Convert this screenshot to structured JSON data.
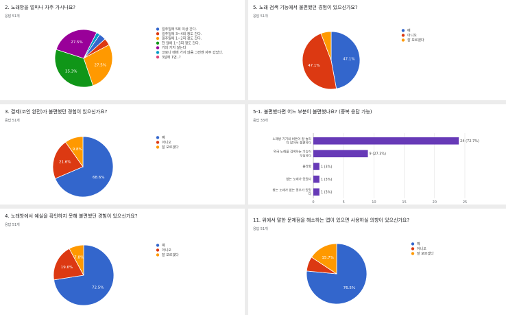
{
  "charts": [
    {
      "id": "q2",
      "title": "2. 노래방을 얼마나 자주 가시나요?",
      "responses": "응답 51개",
      "chart_data": {
        "type": "pie",
        "labels": [
          "일주일에 5회 이상 간다.",
          "일주일에 3~4회 정도 간다.",
          "일주일에 1~2회 정도 간다.",
          "한 달에 1~3회 정도 간다.",
          "거의 가지 않는다",
          "코로나 때에 가지 않음 그전엔 자주 갔었다.",
          "3달에 1번..?"
        ],
        "values": [
          3.9,
          3.9,
          27.5,
          35.3,
          27.5,
          2.0,
          0
        ],
        "colors": [
          "#3366cc",
          "#dc3912",
          "#ff9900",
          "#109618",
          "#990099",
          "#0099c6",
          "#dd4477"
        ],
        "slice_labels": [
          "",
          "",
          "27.5%",
          "35.3%",
          "27.5%",
          "",
          ""
        ]
      }
    },
    {
      "id": "q5",
      "title": "5. 노래 검색 기능에서 불편했던 경험이 있으신가요?",
      "responses": "응답 51개",
      "chart_data": {
        "type": "pie",
        "labels": [
          "예",
          "아니오",
          "잘 모르겠다"
        ],
        "values": [
          47.1,
          47.1,
          5.8
        ],
        "colors": [
          "#3366cc",
          "#dc3912",
          "#ff9900"
        ],
        "slice_labels": [
          "47.1%",
          "47.1%",
          ""
        ]
      }
    },
    {
      "id": "q3",
      "title": "3. 결제(코인 완전)가 불편했던 경험이 있으신가요?",
      "responses": "응답 51개",
      "chart_data": {
        "type": "pie",
        "labels": [
          "예",
          "아니오",
          "잘 모르겠다"
        ],
        "values": [
          68.6,
          21.6,
          9.8
        ],
        "colors": [
          "#3366cc",
          "#dc3912",
          "#ff9900"
        ],
        "slice_labels": [
          "68.6%",
          "21.6%",
          "9.8%"
        ]
      }
    },
    {
      "id": "q51",
      "title": "5-1. 불편했다면 어느 부분이 불편했나요? (중복 응답 가능)",
      "responses": "응답 33개",
      "chart_data": {
        "type": "bar",
        "categories": [
          "노래방 기기의 버튼이 잘 눌리지 않아서 불편하다",
          "외국 노래를 검색하는 기능이 부실하다",
          "몰라할",
          "없는 노래가 있었다",
          "찾는 노래가 없는 경우가 있었다"
        ],
        "values": [
          24,
          9,
          1,
          1,
          1
        ],
        "value_labels": [
          "24 (72.7%)",
          "9 (27.3%)",
          "1 (3%)",
          "1 (3%)",
          "1 (3%)"
        ],
        "xticks": [
          "0",
          "5",
          "10",
          "15",
          "20",
          "25"
        ],
        "xlim": [
          0,
          25
        ],
        "color": "#673ab7"
      }
    },
    {
      "id": "q4",
      "title": "4. 노래방에서 예실을 확인하지 못해 불편했던 경험이 있으신가요?",
      "responses": "응답 51개",
      "chart_data": {
        "type": "pie",
        "labels": [
          "예",
          "아니오",
          "잘 모르겠다"
        ],
        "values": [
          72.5,
          19.6,
          7.9
        ],
        "colors": [
          "#3366cc",
          "#dc3912",
          "#ff9900"
        ],
        "slice_labels": [
          "72.5%",
          "19.6%",
          "7.8%"
        ]
      }
    },
    {
      "id": "q11",
      "title": "11. 위에서 말한 문제점을 해소하는 앱이 있으면 사용하실 의향이 있으신가요?",
      "responses": "응답 51개",
      "chart_data": {
        "type": "pie",
        "labels": [
          "예",
          "아니오",
          "잘 모르겠다"
        ],
        "values": [
          76.5,
          7.8,
          15.7
        ],
        "colors": [
          "#3366cc",
          "#dc3912",
          "#ff9900"
        ],
        "slice_labels": [
          "76.5%",
          "",
          "15.7%"
        ]
      }
    }
  ]
}
